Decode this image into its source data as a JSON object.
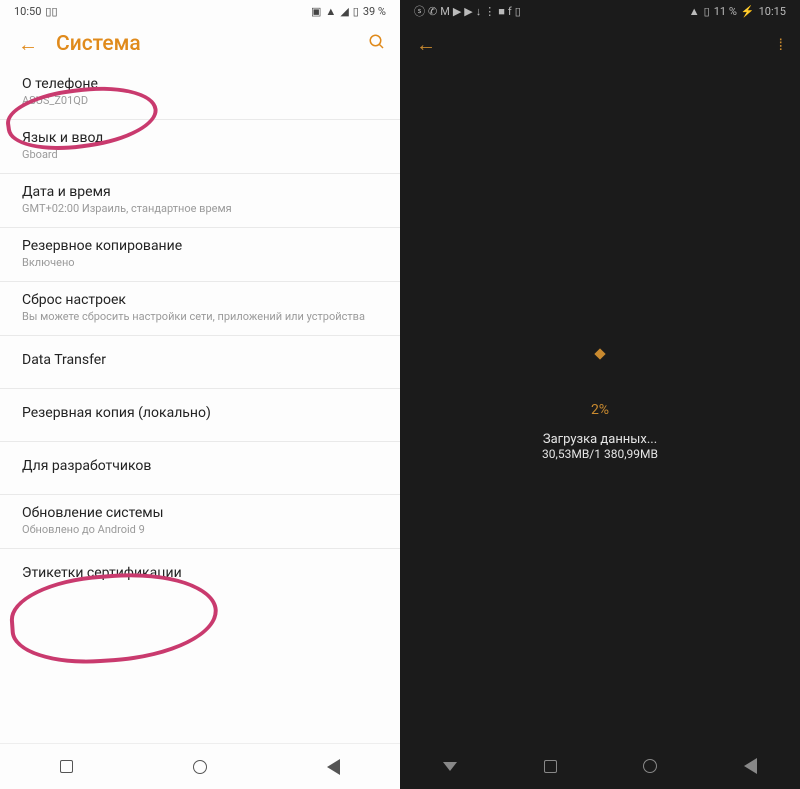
{
  "left": {
    "status": {
      "time": "10:50",
      "battery": "39 %"
    },
    "header": {
      "title": "Система"
    },
    "items": [
      {
        "label": "О телефоне",
        "sub": "ASUS_Z01QD"
      },
      {
        "label": "Язык и ввод",
        "sub": "Gboard"
      },
      {
        "label": "Дата и время",
        "sub": "GMT+02:00 Израиль, стандартное время"
      },
      {
        "label": "Резервное копирование",
        "sub": "Включено"
      },
      {
        "label": "Сброс настроек",
        "sub": "Вы можете сбросить настройки сети, приложений или устройства"
      },
      {
        "label": "Data Transfer",
        "sub": ""
      },
      {
        "label": "Резервная копия (локально)",
        "sub": ""
      },
      {
        "label": "Для разработчиков",
        "sub": ""
      },
      {
        "label": "Обновление системы",
        "sub": "Обновлено до Android 9"
      },
      {
        "label": "Этикетки сертификации",
        "sub": ""
      }
    ]
  },
  "right": {
    "status": {
      "time": "10:15",
      "battery": "11 %"
    },
    "download": {
      "percent": "2%",
      "line1": "Загрузка данных...",
      "line2": "30,53MB/1 380,99MB"
    }
  }
}
